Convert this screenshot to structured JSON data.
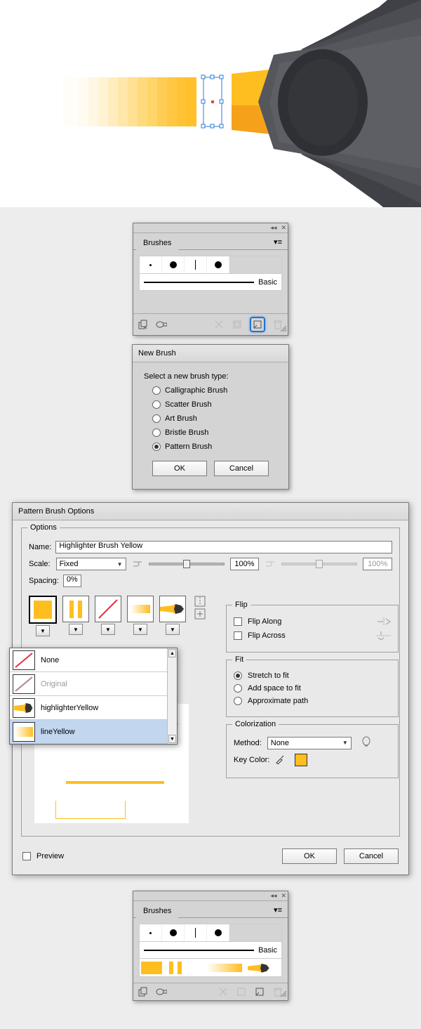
{
  "brushes_panel": {
    "title": "Brushes",
    "basic_label": "Basic"
  },
  "new_brush": {
    "title": "New Brush",
    "prompt": "Select a new brush type:",
    "options": {
      "calligraphic": "Calligraphic Brush",
      "scatter": "Scatter Brush",
      "art": "Art Brush",
      "bristle": "Bristle Brush",
      "pattern": "Pattern Brush"
    },
    "ok": "OK",
    "cancel": "Cancel"
  },
  "pbo": {
    "title": "Pattern Brush Options",
    "options_legend": "Options",
    "name_label": "Name:",
    "name_value": "Highlighter Brush Yellow",
    "scale_label": "Scale:",
    "scale_mode": "Fixed",
    "scale_val": "100%",
    "scale_val2": "100%",
    "spacing_label": "Spacing:",
    "spacing_value": "0%",
    "list": {
      "none": "None",
      "original": "Original",
      "highlighterYellow": "highlighterYellow",
      "lineYellow": "lineYellow"
    },
    "flip": {
      "legend": "Flip",
      "along": "Flip Along",
      "across": "Flip Across"
    },
    "fit": {
      "legend": "Fit",
      "stretch": "Stretch to fit",
      "addspace": "Add space to fit",
      "approx": "Approximate path"
    },
    "colorization": {
      "legend": "Colorization",
      "method_label": "Method:",
      "method_value": "None",
      "keycolor_label": "Key Color:"
    },
    "preview_label": "Preview",
    "ok": "OK",
    "cancel": "Cancel"
  }
}
